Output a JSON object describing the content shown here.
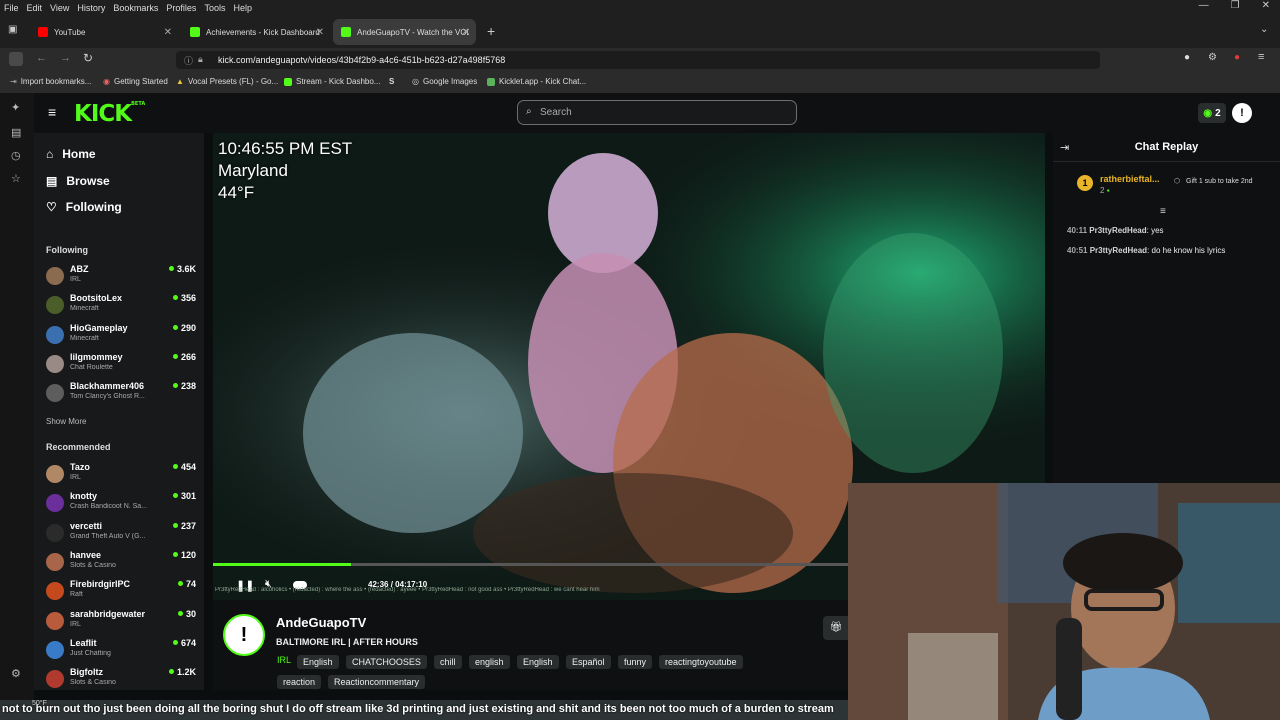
{
  "menubar": {
    "items": [
      "File",
      "Edit",
      "View",
      "History",
      "Bookmarks",
      "Profiles",
      "Tools",
      "Help"
    ]
  },
  "tabs": [
    {
      "label": "YouTube",
      "color": "#ff0000"
    },
    {
      "label": "Achievements - Kick Dashboard",
      "color": "#53fc18"
    },
    {
      "label": "AndeGuapoTV - Watch the VOD",
      "color": "#53fc18"
    }
  ],
  "url": "kick.com/andeguapotv/videos/43b4f2b9-a4c6-451b-b623-d27a498f5768",
  "bookmarks": [
    "Import bookmarks...",
    "Getting Started",
    "Vocal Presets (FL) - Go...",
    "Stream - Kick Dashbo...",
    "Google Images",
    "Kicklet.app - Kick Chat..."
  ],
  "kick": {
    "logo": "KICK",
    "logo_badge": "BETA",
    "search_placeholder": "Search",
    "points_count": "2",
    "accent": "#53fc18"
  },
  "sidebar": {
    "nav": [
      {
        "label": "Home",
        "icon": "home-icon"
      },
      {
        "label": "Browse",
        "icon": "browse-icon"
      },
      {
        "label": "Following",
        "icon": "heart-icon"
      }
    ],
    "following_title": "Following",
    "following": [
      {
        "name": "ABZ",
        "category": "IRL",
        "viewers": "3.6K",
        "color": "#8a6b4f"
      },
      {
        "name": "BootsitoLex",
        "category": "Minecraft",
        "viewers": "356",
        "color": "#4b5e2a"
      },
      {
        "name": "HioGameplay",
        "category": "Minecraft",
        "viewers": "290",
        "color": "#3a6fb0"
      },
      {
        "name": "lilgmommey",
        "category": "Chat Roulette",
        "viewers": "266",
        "color": "#9a8a86"
      },
      {
        "name": "Blackhammer406",
        "category": "Tom Clancy's Ghost R...",
        "viewers": "238",
        "color": "#5d5d5d"
      }
    ],
    "show_more": "Show More",
    "recommended_title": "Recommended",
    "recommended": [
      {
        "name": "Tazo",
        "category": "IRL",
        "viewers": "454",
        "color": "#b08866"
      },
      {
        "name": "knotty",
        "category": "Crash Bandicoot N. Sa...",
        "viewers": "301",
        "color": "#6a2f9a"
      },
      {
        "name": "vercetti",
        "category": "Grand Theft Auto V (G...",
        "viewers": "237",
        "color": "#2b2b2b"
      },
      {
        "name": "hanvee",
        "category": "Slots & Casino",
        "viewers": "120",
        "color": "#a8654a"
      },
      {
        "name": "FirebirdgirlPC",
        "category": "Raft",
        "viewers": "74",
        "color": "#c44a1e"
      },
      {
        "name": "sarahbridgewater",
        "category": "IRL",
        "viewers": "30",
        "color": "#b85a3c"
      },
      {
        "name": "Leaflit",
        "category": "Just Chatting",
        "viewers": "674",
        "color": "#3a7bc8"
      },
      {
        "name": "Bigfoltz",
        "category": "Slots & Casino",
        "viewers": "1.2K",
        "color": "#b03a2e"
      }
    ]
  },
  "video": {
    "overlay_time": "10:46:55 PM EST",
    "overlay_place": "Maryland",
    "overlay_temp": "44°F",
    "current_time": "42:36",
    "separator": "/",
    "duration": "04:17:10",
    "progress": 0.166,
    "ticker": "Pr3ttyRedHead : alcoholics  •  (redacted) : where the ass  •  (redacted) : ayeee  •  Pr3ttyRedHead : not good ass  •  Pr3ttyRedHead : we cant hear him"
  },
  "chat": {
    "title": "Chat Replay",
    "gifter": {
      "name": "ratherbieftal...",
      "rank": "1",
      "count": "2",
      "gift_text": "Gift 1 sub to take 2nd"
    },
    "messages": [
      {
        "time": "40:11",
        "user": "Pr3ttyRedHead",
        "text": "yes"
      },
      {
        "time": "40:51",
        "user": "Pr3ttyRedHead",
        "text": "do he know his lyrics"
      }
    ]
  },
  "stream_info": {
    "channel": "AndeGuapoTV",
    "title": "BALTIMORE IRL | AFTER HOURS",
    "category": "IRL",
    "tags": [
      "English",
      "CHATCHOOSES",
      "chill",
      "english",
      "English",
      "Español",
      "funny",
      "reactingtoyoutube",
      "reaction",
      "Reactioncommentary"
    ]
  },
  "taskbar": {
    "weather": "50°F"
  },
  "caption": "not to burn out tho just been doing all the boring shut I do off stream like 3d printing and just existing and shit and its been not too much of a burden to stream"
}
